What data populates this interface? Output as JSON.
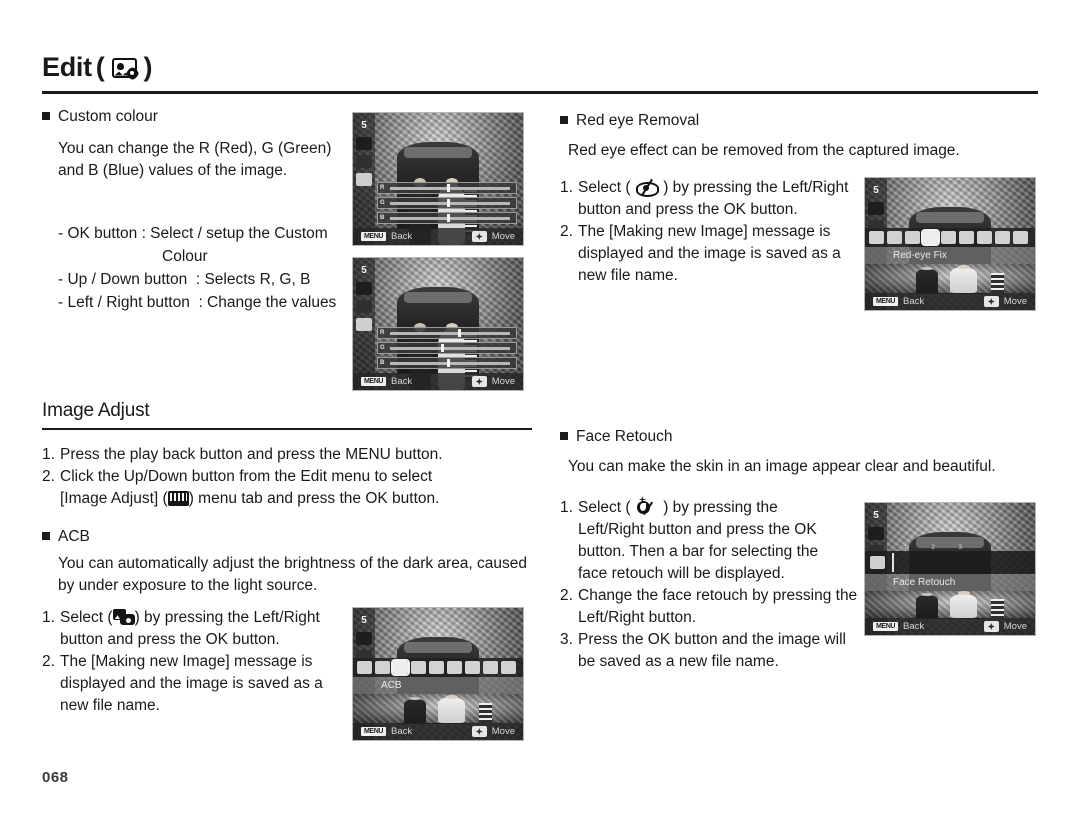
{
  "header": {
    "title": "Edit",
    "paren_open": "(",
    "paren_close": ")",
    "icon": "edit-photo-gear-icon"
  },
  "page_number": "068",
  "left_column": {
    "custom_colour": {
      "heading": "Custom colour",
      "description": "You can change the R (Red), G (Green) and B (Blue) values of the image.",
      "controls": [
        "- OK button : Select / setup the Custom",
        "Colour",
        "- Up / Down button  : Selects R, G, B",
        "- Left / Right button  : Change the values"
      ]
    },
    "image_adjust": {
      "section_title": "Image Adjust",
      "steps": [
        {
          "num": "1.",
          "text": "Press the play back button and press the MENU button."
        },
        {
          "num": "2.",
          "text": "Click the Up/Down button from the Edit menu to select"
        }
      ],
      "step2_cont_before": "[Image Adjust] (",
      "step2_cont_after": ") menu tab and press the OK button.",
      "step2_icon": "image-adjust-icon"
    },
    "acb": {
      "heading": "ACB",
      "description": "You can automatically adjust the brightness of the dark area, caused by under exposure to the light source.",
      "steps": [
        {
          "num": "1.",
          "before": "Select (",
          "icon": "acb-icon",
          "after": ") by pressing the Left/Right",
          "cont": "button and press the OK button."
        },
        {
          "num": "2.",
          "text": "The [Making new Image] message is",
          "cont": "displayed and the image is saved as a",
          "cont2": "new file name."
        }
      ]
    }
  },
  "right_column": {
    "red_eye_removal": {
      "heading": "Red eye Removal",
      "description": "Red eye effect can be removed from the captured image.",
      "steps": [
        {
          "num": "1.",
          "before": "Select (",
          "icon": "red-eye-icon",
          "after": ") by pressing the Left/Right",
          "cont": "button and press the OK button."
        },
        {
          "num": "2.",
          "text": "The [Making new Image] message is",
          "cont": "displayed and the image is saved as a",
          "cont2": "new file name."
        }
      ]
    },
    "face_retouch": {
      "heading": "Face Retouch",
      "description": "You can make the skin in an image appear clear and beautiful.",
      "steps": [
        {
          "num": "1.",
          "before": "Select (",
          "icon": "face-retouch-icon",
          "after": ") by pressing the",
          "cont": "Left/Right button and press the OK",
          "cont2": "button. Then a bar for selecting the",
          "cont3": "face retouch will be displayed."
        },
        {
          "num": "2.",
          "text": "Change the face retouch by pressing the",
          "cont": "Left/Right button."
        },
        {
          "num": "3.",
          "text": "Press the OK button and the image will",
          "cont": "be saved as a new file name."
        }
      ]
    }
  },
  "lcd_screens": {
    "custom_colour_1": {
      "resolution_badge": "5",
      "resolution_unit": "M",
      "back_key": "MENU",
      "back_label": "Back",
      "move_label": "Move",
      "sliders": [
        {
          "label": "R",
          "value": 50
        },
        {
          "label": "G",
          "value": 50
        },
        {
          "label": "B",
          "value": 50
        }
      ]
    },
    "custom_colour_2": {
      "resolution_badge": "5",
      "resolution_unit": "M",
      "back_key": "MENU",
      "back_label": "Back",
      "move_label": "Move",
      "sliders": [
        {
          "label": "R",
          "value": 58
        },
        {
          "label": "G",
          "value": 46
        },
        {
          "label": "B",
          "value": 50
        }
      ]
    },
    "red_eye_fix": {
      "resolution_badge": "5",
      "resolution_unit": "M",
      "menu_label": "Red-eye Fix",
      "back_key": "MENU",
      "back_label": "Back",
      "move_label": "Move",
      "selected_index": 3,
      "icons": [
        "resize-icon",
        "rotate-icon",
        "acb-icon",
        "red-eye-icon",
        "face-retouch-icon",
        "brightness-icon",
        "contrast-icon",
        "saturation-icon",
        "noise-icon"
      ]
    },
    "acb_menu": {
      "resolution_badge": "5",
      "resolution_unit": "M",
      "menu_label": "ACB",
      "back_key": "MENU",
      "back_label": "Back",
      "move_label": "Move",
      "selected_index": 2,
      "icons": [
        "resize-icon",
        "rotate-icon",
        "acb-icon",
        "red-eye-icon",
        "face-retouch-icon",
        "brightness-icon",
        "contrast-icon",
        "saturation-icon",
        "noise-icon"
      ]
    },
    "face_retouch_menu": {
      "resolution_badge": "5",
      "resolution_unit": "M",
      "menu_label": "Face Retouch",
      "back_key": "MENU",
      "back_label": "Back",
      "move_label": "Move",
      "levels": [
        "1",
        "2",
        "3"
      ],
      "level_value": 1
    }
  }
}
